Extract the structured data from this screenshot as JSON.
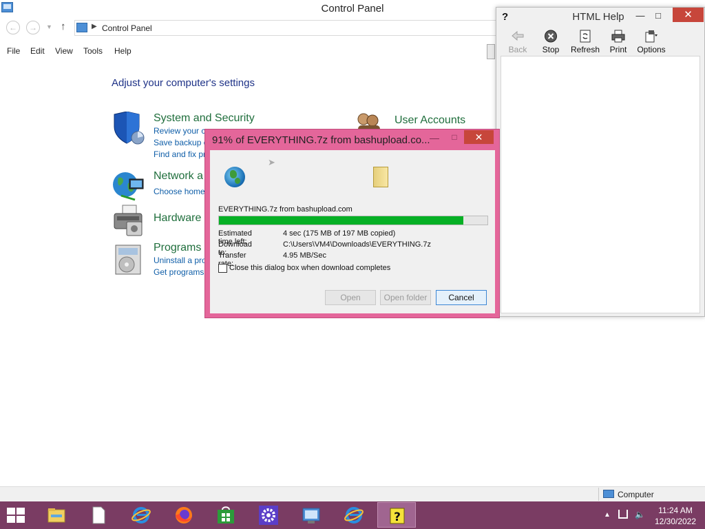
{
  "control_panel": {
    "title": "Control Panel",
    "breadcrumb": "Control Panel",
    "menu": [
      "File",
      "Edit",
      "View",
      "Tools",
      "Help"
    ],
    "heading": "Adjust your computer's settings",
    "categories": [
      {
        "title": "System and Security",
        "links": [
          "Review your c",
          "Save backup c",
          "Find and fix pr"
        ]
      },
      {
        "title": "Network a",
        "links": [
          "Choose home"
        ]
      },
      {
        "title": "Hardware a",
        "links": []
      },
      {
        "title": "Programs",
        "links": [
          "Uninstall a pro",
          "Get programs"
        ]
      },
      {
        "title": "User Accounts",
        "links": []
      }
    ]
  },
  "help_window": {
    "title": "HTML Help",
    "toolbar": [
      "Back",
      "Stop",
      "Refresh",
      "Print",
      "Options"
    ]
  },
  "download_dialog": {
    "title": "91% of EVERYTHING.7z from bashupload.co...",
    "source": "EVERYTHING.7z from bashupload.com",
    "progress": 0.91,
    "rows": [
      {
        "label": "Estimated time left:",
        "value": "4 sec (175 MB of 197 MB copied)"
      },
      {
        "label": "Download to:",
        "value": "C:\\Users\\VM4\\Downloads\\EVERYTHING.7z"
      },
      {
        "label": "Transfer rate:",
        "value": "4.95 MB/Sec"
      }
    ],
    "close_when_done_label": "Close this dialog box when download completes",
    "close_when_done_checked": false,
    "buttons": {
      "open": "Open",
      "open_folder": "Open folder",
      "cancel": "Cancel"
    }
  },
  "status_bar": {
    "zone": "Computer"
  },
  "taskbar": {
    "apps": [
      "file-explorer",
      "notepad",
      "internet-explorer",
      "firefox",
      "store",
      "settings",
      "control-panel",
      "internet-explorer",
      "html-help"
    ],
    "active_app": "html-help",
    "clock_time": "11:24 AM",
    "clock_date": "12/30/2022"
  },
  "colors": {
    "accent": "#e4669a",
    "taskbar": "#7a3c63",
    "progress": "#06b025",
    "close": "#c7463b",
    "category_title": "#1f6e3c",
    "link": "#0f5ea8"
  }
}
